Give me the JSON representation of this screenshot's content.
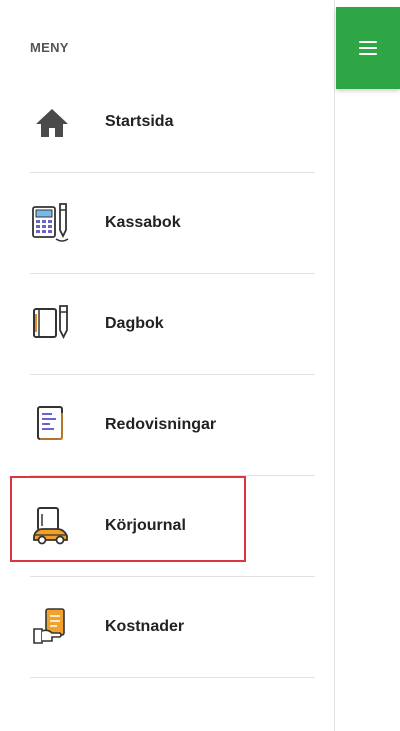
{
  "sidebar": {
    "heading": "MENY",
    "items": [
      {
        "label": "Startsida",
        "icon": "home-icon"
      },
      {
        "label": "Kassabok",
        "icon": "calculator-pen-icon"
      },
      {
        "label": "Dagbok",
        "icon": "notebook-pen-icon"
      },
      {
        "label": "Redovisningar",
        "icon": "document-icon"
      },
      {
        "label": "Körjournal",
        "icon": "car-logbook-icon",
        "highlighted": true
      },
      {
        "label": "Kostnader",
        "icon": "hand-receipt-icon"
      }
    ]
  },
  "header": {
    "menu_toggle_icon": "hamburger-icon",
    "accent_color": "#2fa645"
  },
  "highlight_color": "#d9363e"
}
